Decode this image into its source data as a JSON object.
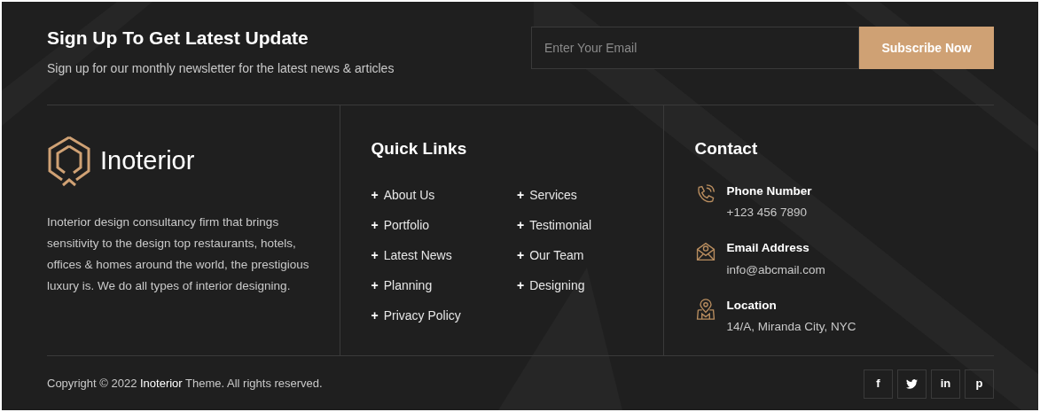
{
  "newsletter": {
    "title": "Sign Up To Get Latest Update",
    "subtitle": "Sign up for our monthly newsletter for the latest news & articles",
    "email": {
      "placeholder": "Enter Your Email"
    },
    "button": "Subscribe Now"
  },
  "about": {
    "brand": "Inoterior",
    "text": "Inoterior design consultancy firm that brings sensitivity to the design top restaurants, hotels, offices & homes around the world, the prestigious luxury is. We do all types of interior designing."
  },
  "quick_links": {
    "title": "Quick Links",
    "bullet": "+",
    "columns": [
      [
        "About Us",
        "Portfolio",
        "Latest News",
        "Planning",
        "Privacy Policy"
      ],
      [
        "Services",
        "Testimonial",
        "Our Team",
        "Designing"
      ]
    ]
  },
  "contact": {
    "title": "Contact",
    "items": [
      {
        "kind": "phone",
        "label": "Phone Number",
        "value": "+123 456 7890"
      },
      {
        "kind": "email",
        "label": "Email Address",
        "value": "info@abcmail.com"
      },
      {
        "kind": "location",
        "label": "Location",
        "value": "14/A, Miranda City, NYC"
      }
    ]
  },
  "copyright": {
    "before": "Copyright © 2022",
    "brand": "Inoterior",
    "after": "Theme. All rights reserved."
  },
  "social": [
    {
      "kind": "glyph",
      "text": "f"
    },
    {
      "kind": "bird"
    },
    {
      "kind": "glyph",
      "text": "in"
    },
    {
      "kind": "glyph",
      "text": "p"
    }
  ]
}
